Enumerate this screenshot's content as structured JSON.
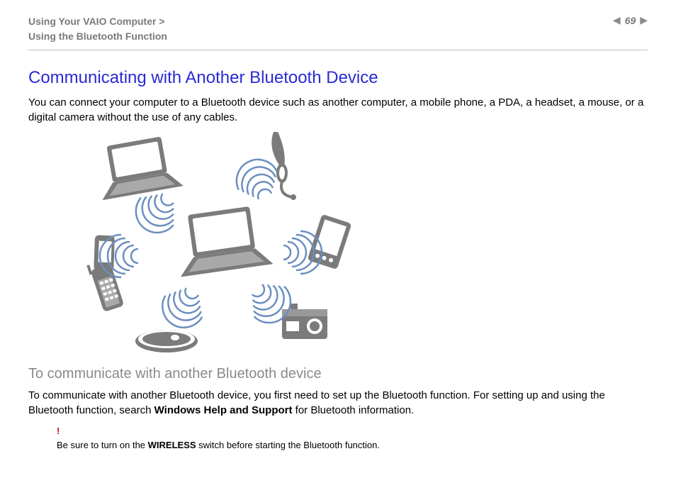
{
  "header": {
    "breadcrumb_line1": "Using Your VAIO Computer >",
    "breadcrumb_line2": "Using the Bluetooth Function",
    "page_number": "69",
    "prev_glyph": "◀",
    "next_glyph": "▶"
  },
  "title": "Communicating with Another Bluetooth Device",
  "intro": "You can connect your computer to a Bluetooth device such as another computer, a mobile phone, a PDA, a headset, a mouse, or a digital camera without the use of any cables.",
  "subhead": "To communicate with another Bluetooth device",
  "para2_a": "To communicate with another Bluetooth device, you first need to set up the Bluetooth function. For setting up and using the Bluetooth function, search ",
  "para2_b": "Windows Help and Support",
  "para2_c": " for Bluetooth information.",
  "note": {
    "excl": "!",
    "pre": "Be sure to turn on the ",
    "bold": "WIRELESS",
    "post": " switch before starting the Bluetooth function."
  }
}
